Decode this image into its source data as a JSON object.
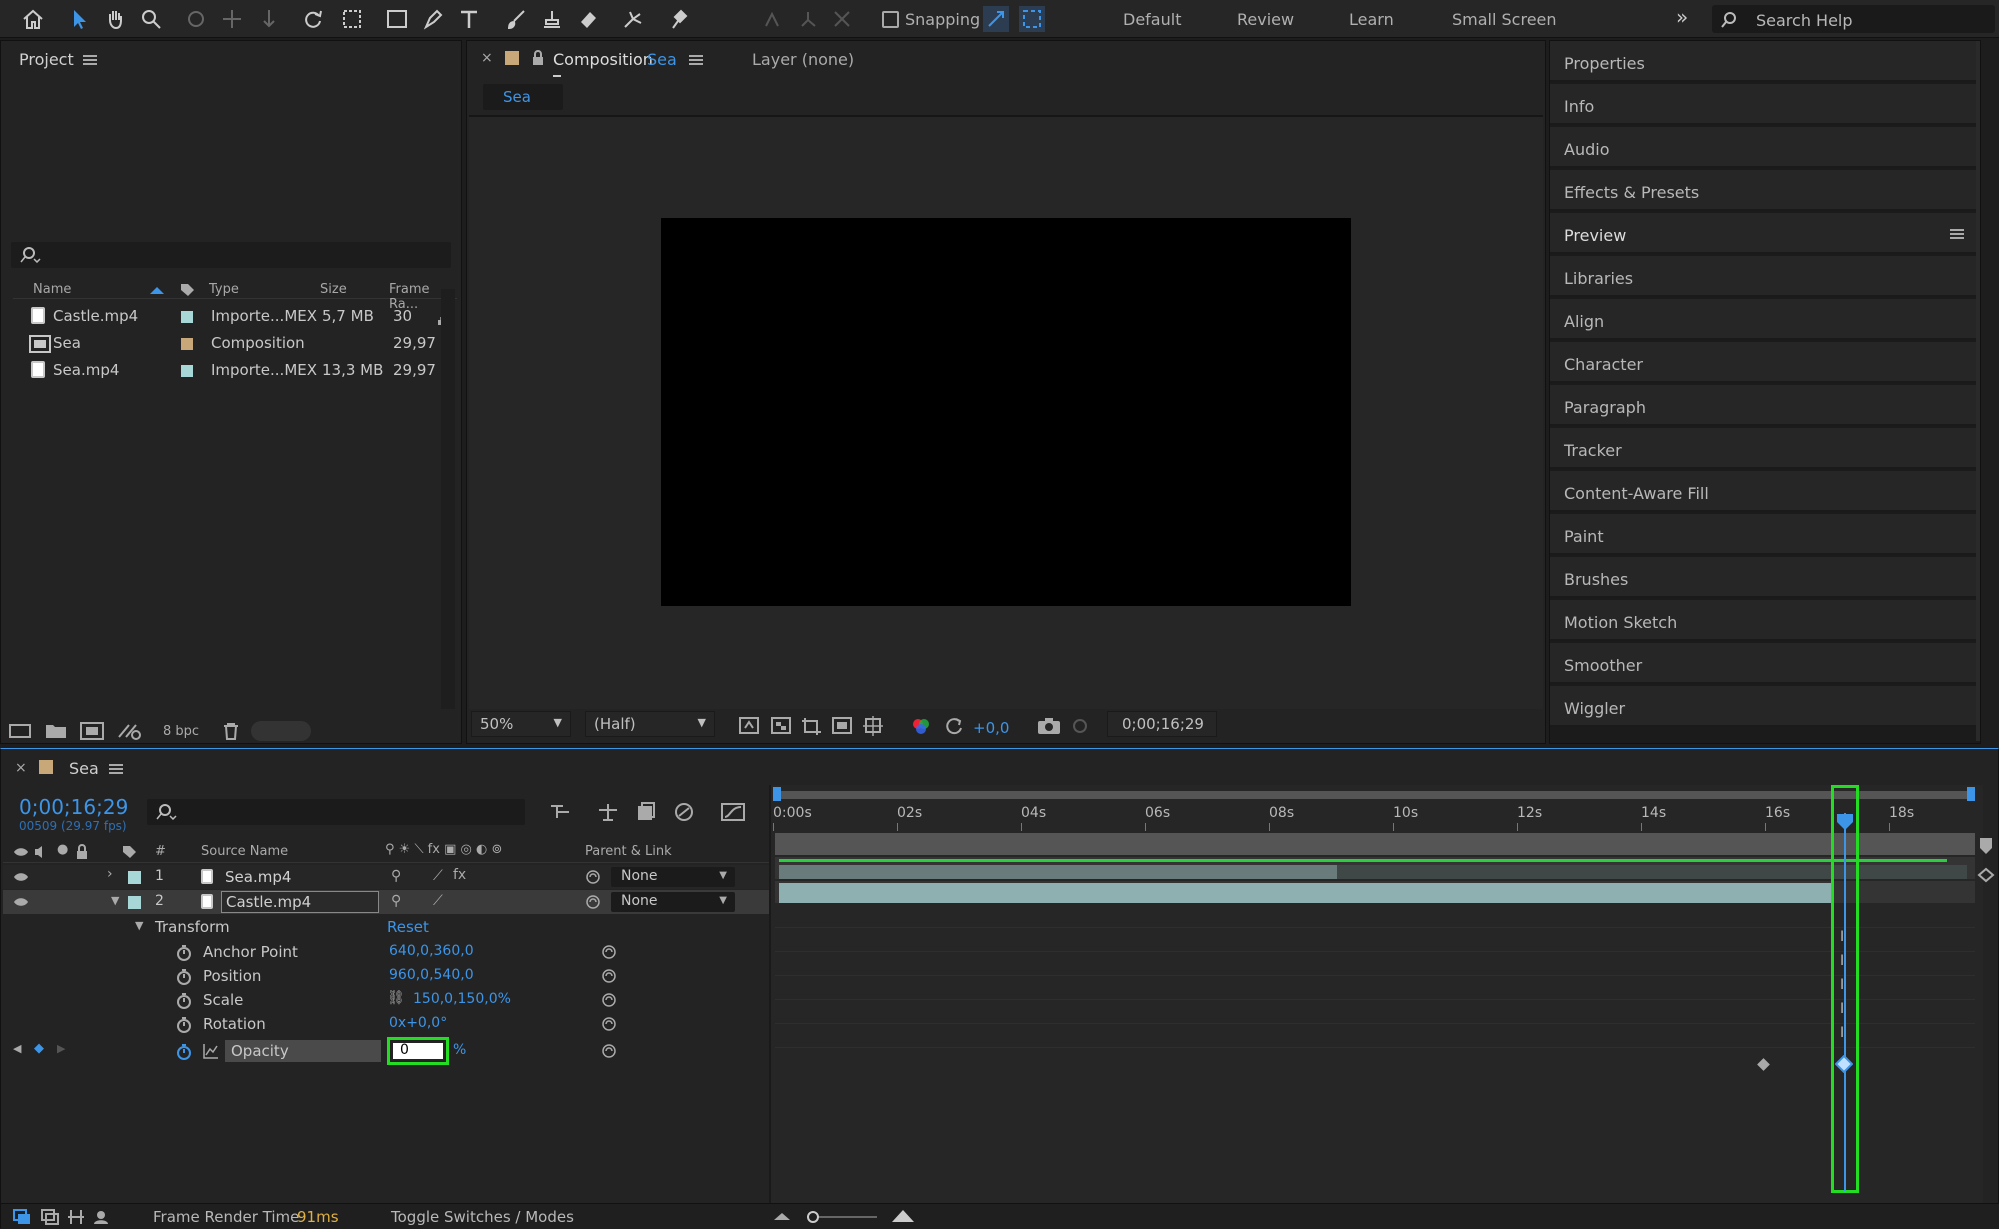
{
  "toolbar": {
    "snapping_label": "Snapping",
    "workspaces": [
      "Default",
      "Review",
      "Learn",
      "Small Screen"
    ],
    "search_placeholder": "Search Help"
  },
  "project": {
    "title": "Project",
    "columns": {
      "name": "Name",
      "type": "Type",
      "size": "Size",
      "frame_rate": "Frame Ra..."
    },
    "items": [
      {
        "name": "Castle.mp4",
        "type": "Importe...MEX",
        "size": "5,7 MB",
        "frame_rate": "30",
        "color": "#a8d7d7",
        "icon": "footage-icon"
      },
      {
        "name": "Sea",
        "type": "Composition",
        "size": "",
        "frame_rate": "29,97",
        "color": "#c8a878",
        "icon": "composition-icon"
      },
      {
        "name": "Sea.mp4",
        "type": "Importe...MEX",
        "size": "13,3 MB",
        "frame_rate": "29,97",
        "color": "#a8d7d7",
        "icon": "footage-icon"
      }
    ],
    "bpc": "8 bpc"
  },
  "composition": {
    "tab_prefix": "Composition",
    "tab_name": "Sea",
    "layer_tab": "Layer (none)",
    "breadcrumb": "Sea",
    "zoom": "50%",
    "resolution": "(Half)",
    "exposure": "+0,0",
    "timecode": "0;00;16;29"
  },
  "right_panels": [
    "Properties",
    "Info",
    "Audio",
    "Effects & Presets",
    "Preview",
    "Libraries",
    "Align",
    "Character",
    "Paragraph",
    "Tracker",
    "Content-Aware Fill",
    "Paint",
    "Brushes",
    "Motion Sketch",
    "Smoother",
    "Wiggler"
  ],
  "timeline": {
    "comp_name": "Sea",
    "timecode": "0;00;16;29",
    "frame_info": "00509 (29.97 fps)",
    "columns": {
      "number": "#",
      "source_name": "Source Name",
      "parent": "Parent & Link"
    },
    "layers": [
      {
        "number": "1",
        "name": "Sea.mp4",
        "parent": "None"
      },
      {
        "number": "2",
        "name": "Castle.mp4",
        "parent": "None"
      }
    ],
    "transform": {
      "label": "Transform",
      "reset": "Reset",
      "properties": [
        {
          "name": "Anchor Point",
          "value": "640,0,360,0"
        },
        {
          "name": "Position",
          "value": "960,0,540,0"
        },
        {
          "name": "Scale",
          "value": "150,0,150,0%"
        },
        {
          "name": "Rotation",
          "value": "0x+0,0°"
        }
      ],
      "opacity_label": "Opacity",
      "opacity_value": "0",
      "opacity_unit": "%"
    },
    "ruler": [
      "0:00s",
      "02s",
      "04s",
      "06s",
      "08s",
      "10s",
      "12s",
      "14s",
      "16s",
      "18s"
    ],
    "footer": {
      "render_label": "Frame Render Time",
      "render_value": "91ms",
      "toggle": "Toggle Switches / Modes"
    }
  },
  "colors": {
    "accent": "#3d95e8",
    "highlight": "#22dd22",
    "work_bar": "#2ecc40"
  }
}
